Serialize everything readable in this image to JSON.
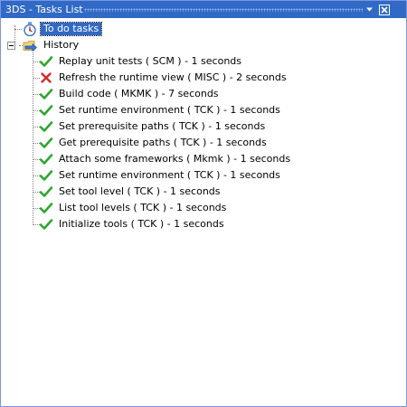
{
  "window": {
    "title": "3DS - Tasks List"
  },
  "tree": {
    "todo": {
      "label": "To do tasks",
      "icon": "stopwatch-icon"
    },
    "history": {
      "label": "History",
      "icon": "history-folder-icon",
      "items": [
        {
          "label": "Replay unit tests ( SCM ) - 1 seconds",
          "status": "success"
        },
        {
          "label": "Refresh the runtime view ( MISC ) - 2 seconds",
          "status": "failed"
        },
        {
          "label": "Build code ( MKMK ) - 7 seconds",
          "status": "success"
        },
        {
          "label": "Set runtime environment ( TCK ) - 1 seconds",
          "status": "success"
        },
        {
          "label": "Set prerequisite paths ( TCK ) - 1 seconds",
          "status": "success"
        },
        {
          "label": "Get prerequisite paths ( TCK ) - 1 seconds",
          "status": "success"
        },
        {
          "label": "Attach some frameworks ( Mkmk ) - 1 seconds",
          "status": "success"
        },
        {
          "label": "Set runtime environment ( TCK ) - 1 seconds",
          "status": "success"
        },
        {
          "label": "Set tool level ( TCK ) - 1 seconds",
          "status": "success"
        },
        {
          "label": "List tool levels ( TCK ) - 1 seconds",
          "status": "success"
        },
        {
          "label": "Initialize tools ( TCK ) - 1 seconds",
          "status": "success"
        }
      ]
    }
  },
  "colors": {
    "titlebar": "#3169c6",
    "selection": "#3169c6",
    "success": "#2fa52f",
    "failed": "#d42a2a"
  }
}
